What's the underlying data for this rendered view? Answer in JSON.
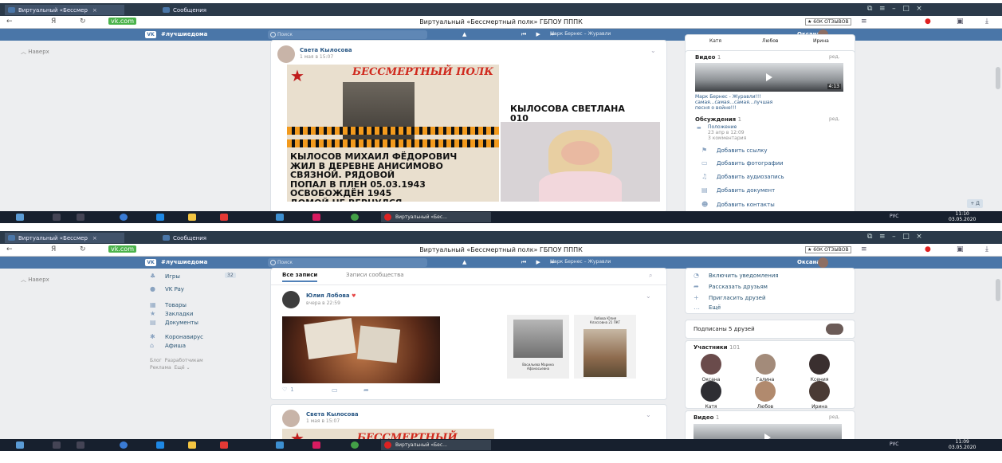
{
  "browser": {
    "tab1": "Виртуальный «Бессмер",
    "tab2": "Сообщения",
    "site_badge": "vk.com",
    "page_title": "Виртуальный «Бессмертный полк» ГБПОУ ПППК",
    "reviews": "★ 60К ОТЗЫВОВ",
    "back": "←",
    "letter": "Я",
    "reload": "↻"
  },
  "vkheader": {
    "logo": "VK",
    "hashtag": "#лучшиедома",
    "search_placeholder": "Поиск",
    "player_controls": "⏮ ▶ ⏭",
    "track": "Марк Бернес – Журавли",
    "user_name": "Оксана"
  },
  "left_menu": {
    "top": "︿ Наверх",
    "items": [
      "Игры",
      "VK Pay",
      "Товары",
      "Закладки",
      "Документы",
      "Коронавирус",
      "Афиша"
    ],
    "games_badge": "32",
    "footer": "Блог  Разработчикам\nРеклама  Ещё ⌄"
  },
  "feed": {
    "tab_all": "Все записи",
    "tab_community": "Записи сообщества",
    "post1": {
      "author": "Юлия Лобова",
      "date": "вчера в 22:59",
      "photo2_caption": "Лобова Юлия\nКлассовна 21 ПКГ",
      "photo3_caption": "Васильева Марина\nАфанасьевна",
      "likes": "1"
    },
    "post2": {
      "author": "Света Кылосова",
      "date": "1 мая в 15:07",
      "banner": "БЕССМЕРТНЫЙ ПОЛК",
      "caption": "КЫЛОСОВ МИХАИЛ ФЁДОРОВИЧ\nЖИЛ В ДЕРЕВНЕ АНИСИМОВО\nСВЯЗНОЙ. РЯДОВОЙ\nПОПАЛ В ПЛЕН 05.03.1943\nОСВОБОЖДЁН 1945\nДОМОЙ НЕ ВЕРНУЛСЯ",
      "name_right": "КЫЛОСОВА СВЕТЛАНА\n010"
    }
  },
  "right_col": {
    "actions": [
      "Включить уведомления",
      "Рассказать друзьям",
      "Пригласить друзей",
      "Ещё"
    ],
    "friends_sub": "Подписаны 5 друзей",
    "members_title": "Участники",
    "members_count": "101",
    "members": [
      "Оксана",
      "Галина",
      "Ксения",
      "Катя",
      "Любов",
      "Ирина"
    ],
    "video_title": "Видео",
    "video_count": "1",
    "edit": "ред.",
    "video_caption": "Марк Бернес - Журавли!!!\nсамая...самая...самая...лучшая\nпесня о войне!!!",
    "video_duration": "4:13",
    "discussions_title": "Обсуждения",
    "discussions_count": "1",
    "topic": "Положение",
    "topic_date": "23 апр в 12:09",
    "topic_comments": "3 комментария",
    "add_actions": [
      "Добавить ссылку",
      "Добавить фотографии",
      "Добавить аудиозапись",
      "Добавить документ",
      "Добавить контакты"
    ]
  },
  "taskbar": {
    "app_label": "Виртуальный «Бес...",
    "lang": "РУС",
    "time1": "11:10",
    "time2": "11:09",
    "date": "03.05.2020"
  },
  "zoom_badge": "+ Д"
}
